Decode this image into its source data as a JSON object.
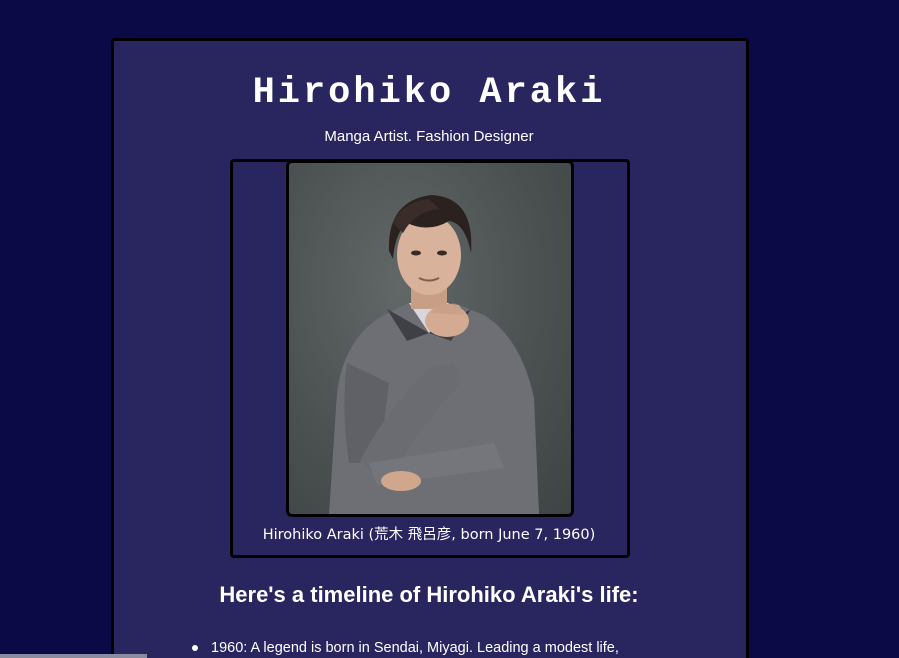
{
  "header": {
    "title": "Hirohiko Araki",
    "subtitle": "Manga Artist. Fashion Designer"
  },
  "photo": {
    "caption": "Hirohiko Araki (荒木 飛呂彦, born June 7, 1960)"
  },
  "timeline": {
    "heading": "Here's a timeline of Hirohiko Araki's life:",
    "items": [
      "1960: A legend is born in Sendai, Miyagi. Leading a modest life,"
    ]
  },
  "colors": {
    "page_background": "#0b0a46",
    "card_background": "#29255e",
    "text": "#ffffff",
    "border": "#000000"
  }
}
